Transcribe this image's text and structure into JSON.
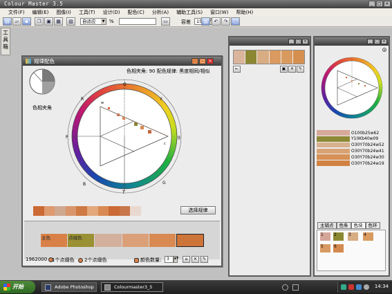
{
  "app": {
    "title": "Colour Master 3.5",
    "controls": [
      "_",
      "□",
      "×"
    ]
  },
  "menu": [
    "文件(F)",
    "编辑(E)",
    "图像(I)",
    "工具(T)",
    "设计(D)",
    "配色(C)",
    "分析(A)",
    "辅助工具(S)",
    "窗口(W)",
    "帮助(H)"
  ],
  "toolbar": {
    "zoom": "自适应",
    "percent": "%",
    "tolerance_label": "容差",
    "tolerance_value": "15",
    "spin": "▲▼",
    "dropdown": "▼"
  },
  "toolbox": {
    "label": "工具箱"
  },
  "harmony_window": {
    "title": "规律配色",
    "info": "色相夹角: 90  配色规律: 黑度相同/相似",
    "hue_angle_label": "色相夹角",
    "wheel_labels": [
      "O",
      "Y",
      "g",
      "G",
      "T",
      "B",
      "P",
      "R",
      "w",
      "c"
    ],
    "select_rule_button": "选择规律",
    "palette_labels": [
      "主色",
      "点缀色"
    ],
    "palette_colors": [
      "#d88048",
      "#9a9034",
      "#d2b09c",
      "#dba078",
      "#d88a52",
      "#cd7438"
    ],
    "bar_strip": [
      "#cb6a34",
      "#df9a70",
      "#cfa890",
      "#d9956c",
      "#cf7944",
      "#e3a87c",
      "#d88a52",
      "#cb6a34",
      "#c8764a",
      "#e8d8d0"
    ],
    "footer": {
      "count": "1962000",
      "one_point": "1个点缀色",
      "two_point": "2个点缀色",
      "color_count_label": "颜色数量:",
      "color_count_value": "3"
    }
  },
  "mid_window": {
    "swatches": [
      "#dbb59b",
      "#8c8732",
      "#d8ad83",
      "#db9a60",
      "#d99a60",
      "#d59050"
    ]
  },
  "right_window": {
    "color_codes": [
      {
        "code": "O100b25w62",
        "color": "#d7a99a"
      },
      {
        "code": "Y10Kb40w09",
        "color": "#8f8936"
      },
      {
        "code": "O30Y70b24w52",
        "color": "#d8b18c"
      },
      {
        "code": "O30Y70b24w41",
        "color": "#d9a273"
      },
      {
        "code": "O30Y70b24w30",
        "color": "#d59156"
      },
      {
        "code": "O30Y70b24w19",
        "color": "#d18342"
      }
    ],
    "tabs": [
      "主辅点",
      "色条",
      "色块",
      "色环"
    ],
    "palette_items": [
      {
        "num": "1",
        "color": "#d6a59a"
      },
      {
        "num": "2",
        "color": "#8c8832"
      },
      {
        "num": "3",
        "color": "#d8ad83"
      },
      {
        "num": "4",
        "color": "#d99a60"
      },
      {
        "num": "5",
        "color": "#d89a62"
      },
      {
        "num": "6",
        "color": "#d48a4e"
      }
    ]
  },
  "taskbar": {
    "start": "开始",
    "tasks": [
      "Adobe Photoshop",
      "Colourmaster3_5"
    ],
    "clock": "14:34"
  }
}
